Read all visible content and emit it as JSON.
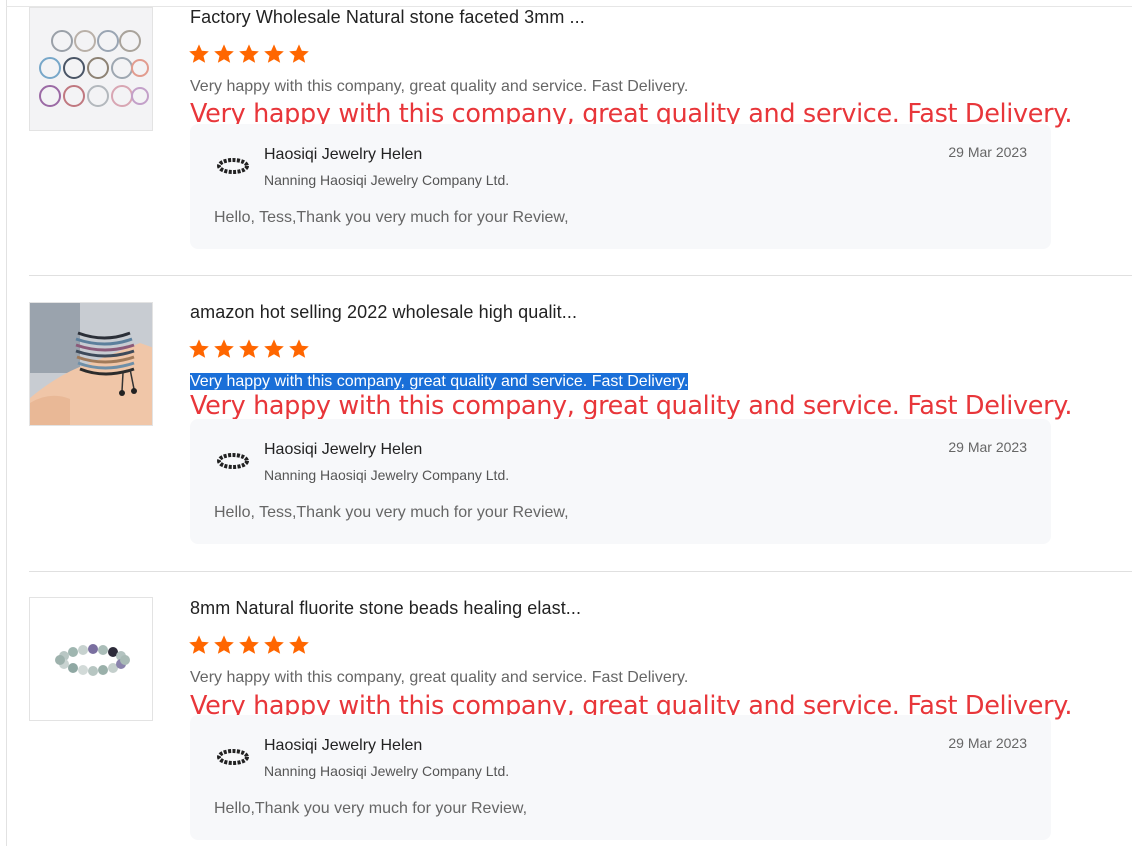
{
  "colors": {
    "star": "#ff6600",
    "overlay_text": "#e8363a",
    "selection": "#1a6fd8",
    "reply_background": "#f7f8fa"
  },
  "reviews": [
    {
      "product_title": "Factory Wholesale Natural stone faceted 3mm ...",
      "thumbnail_icon": "bracelet-set-image",
      "rating": 5,
      "review_text": "Very happy with this company, great quality and service. Fast Delivery.",
      "review_text_selected": false,
      "overlay_text": "Very happy with this company, great quality and service. Fast Delivery.",
      "reply": {
        "avatar_icon": "bracelet-avatar-icon",
        "name": "Haosiqi Jewelry Helen",
        "company": "Nanning Haosiqi Jewelry Company Ltd.",
        "date": "29 Mar 2023",
        "text": "Hello, Tess,Thank you very much for your Review,"
      }
    },
    {
      "product_title": "amazon hot selling 2022 wholesale high qualit...",
      "thumbnail_icon": "wrist-bracelets-image",
      "rating": 5,
      "review_text": "Very happy with this company, great quality and service. Fast Delivery.",
      "review_text_selected": true,
      "overlay_text": "Very happy with this company, great quality and service. Fast Delivery.",
      "reply": {
        "avatar_icon": "bracelet-avatar-icon",
        "name": "Haosiqi Jewelry Helen",
        "company": "Nanning Haosiqi Jewelry Company Ltd.",
        "date": "29 Mar 2023",
        "text": "Hello, Tess,Thank you very much for your Review,"
      }
    },
    {
      "product_title": "8mm Natural fluorite stone beads healing elast...",
      "thumbnail_icon": "fluorite-bracelet-image",
      "rating": 5,
      "review_text": "Very happy with this company, great quality and service. Fast Delivery.",
      "review_text_selected": false,
      "overlay_text": "Very happy with this company, great quality and service. Fast Delivery.",
      "reply": {
        "avatar_icon": "bracelet-avatar-icon",
        "name": "Haosiqi Jewelry Helen",
        "company": "Nanning Haosiqi Jewelry Company Ltd.",
        "date": "29 Mar 2023",
        "text": "Hello,Thank you very much for your Review,"
      }
    }
  ]
}
